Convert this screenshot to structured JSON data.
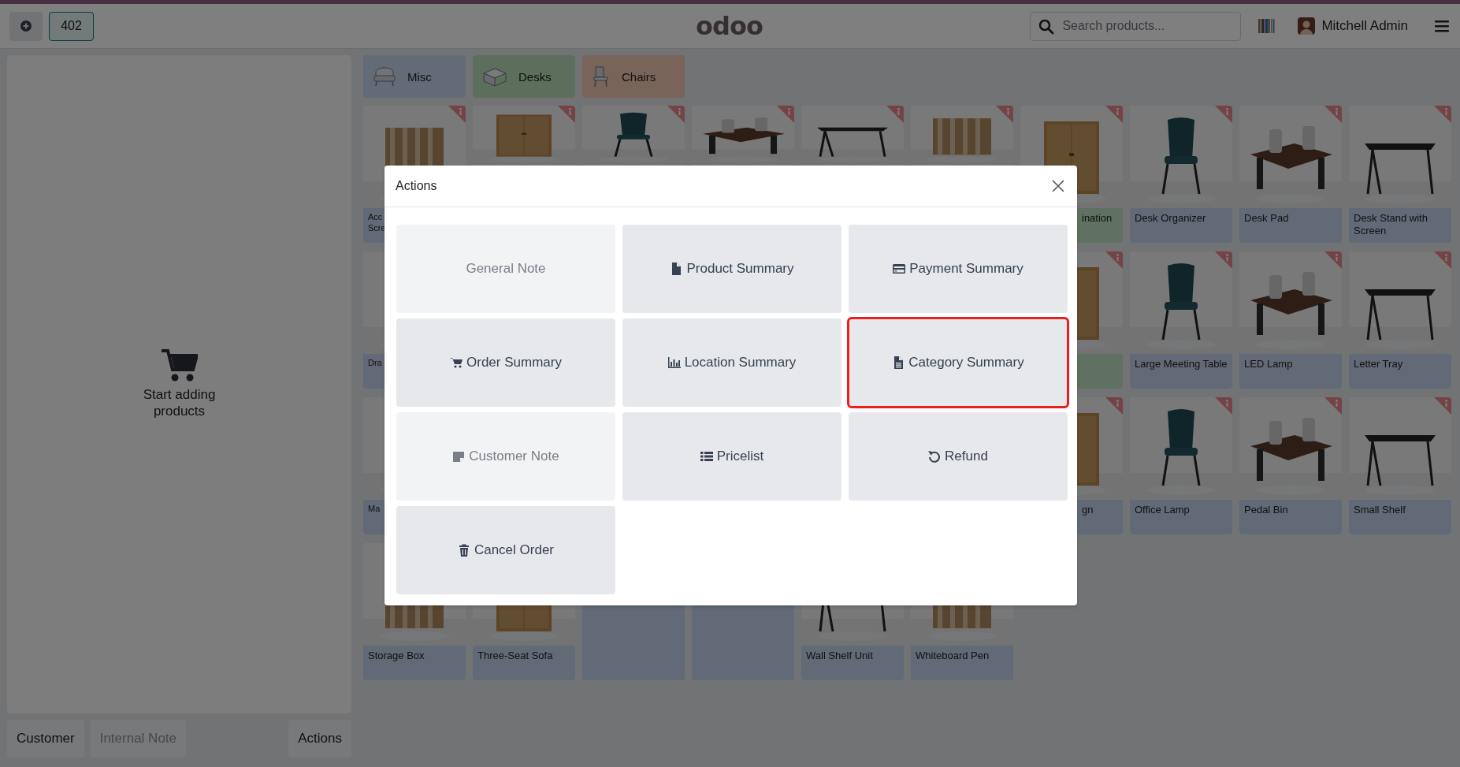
{
  "top_bar": {
    "order_tab": {
      "label": "402",
      "selected": true
    },
    "logo": "odoo",
    "search": {
      "placeholder": "Search products..."
    },
    "user": "Mitchell Admin"
  },
  "categories": [
    {
      "label": "Misc",
      "kind": "misc"
    },
    {
      "label": "Desks",
      "kind": "desk"
    },
    {
      "label": "Chairs",
      "kind": "chair"
    }
  ],
  "order_panel": {
    "empty_message": "Start adding products"
  },
  "order_buttons": [
    {
      "label": "Customer",
      "disabled": false
    },
    {
      "label": "Internal Note",
      "disabled": true
    },
    {
      "label": "Actions",
      "disabled": false
    }
  ],
  "products": [
    [
      {
        "kind": "misc",
        "name": "Acc Scre",
        "covered_left": false,
        "covered_right": true
      },
      {
        "kind": "misc"
      },
      {
        "kind": "misc"
      },
      {
        "kind": "misc"
      },
      {
        "kind": "misc"
      },
      {
        "kind": "misc"
      },
      {
        "kind": "desk",
        "name": "ination",
        "covered_left": true,
        "covered_right": false
      },
      {
        "kind": "misc",
        "name": "Desk Organizer",
        "covered_left": false,
        "covered_right": false
      },
      {
        "kind": "misc",
        "name": "Desk Pad",
        "covered_left": false,
        "covered_right": false
      },
      {
        "kind": "misc",
        "name": "Desk Stand with Screen",
        "covered_left": false,
        "covered_right": false
      }
    ],
    [
      {
        "kind": "misc",
        "name": "Dra",
        "covered_left": false,
        "covered_right": true
      },
      {
        "kind": "desk",
        "gap_before": true
      },
      {
        "kind": "misc",
        "name": "Large Meeting Table",
        "covered_left": false,
        "covered_right": false
      },
      {
        "kind": "misc",
        "name": "LED Lamp",
        "covered_left": false,
        "covered_right": false
      },
      {
        "kind": "misc",
        "name": "Letter Tray",
        "covered_left": false,
        "covered_right": false
      }
    ],
    [
      {
        "kind": "misc",
        "name": "Ma",
        "covered_left": false,
        "covered_right": true
      },
      {
        "kind": "misc",
        "name": "gn",
        "covered_left": true,
        "covered_right": false,
        "gap_before": true
      },
      {
        "kind": "misc",
        "name": "Office Lamp",
        "covered_left": false,
        "covered_right": false
      },
      {
        "kind": "misc",
        "name": "Pedal Bin",
        "covered_left": false,
        "covered_right": false
      },
      {
        "kind": "misc",
        "name": "Small Shelf",
        "covered_left": false,
        "covered_right": false
      }
    ],
    [
      {
        "kind": "misc",
        "name": "Storage Box",
        "covered_left": false,
        "covered_right": false
      },
      {
        "kind": "misc",
        "name": "Three-Seat Sofa",
        "covered_left": false,
        "covered_right": false
      },
      {
        "kind": "blank"
      },
      {
        "kind": "blank"
      },
      {
        "kind": "misc",
        "name": "Wall Shelf Unit",
        "covered_left": false,
        "covered_right": false
      },
      {
        "kind": "misc",
        "name": "Whiteboard Pen",
        "covered_left": false,
        "covered_right": false
      }
    ]
  ],
  "dialog": {
    "title": "Actions",
    "actions": [
      {
        "label": "General Note",
        "disabled": true,
        "highlighted": false
      },
      {
        "label": "Product Summary",
        "disabled": false,
        "highlighted": false
      },
      {
        "label": "Payment Summary",
        "disabled": false,
        "highlighted": false
      },
      {
        "label": "Order Summary",
        "disabled": false,
        "highlighted": false
      },
      {
        "label": "Location Summary",
        "disabled": false,
        "highlighted": false
      },
      {
        "label": "Category Summary",
        "disabled": false,
        "highlighted": true
      },
      {
        "label": "Customer Note",
        "disabled": true,
        "highlighted": false
      },
      {
        "label": "Pricelist",
        "disabled": false,
        "highlighted": false
      },
      {
        "label": "Refund",
        "disabled": false,
        "highlighted": false
      },
      {
        "label": "Cancel Order",
        "disabled": false,
        "highlighted": false
      }
    ]
  }
}
